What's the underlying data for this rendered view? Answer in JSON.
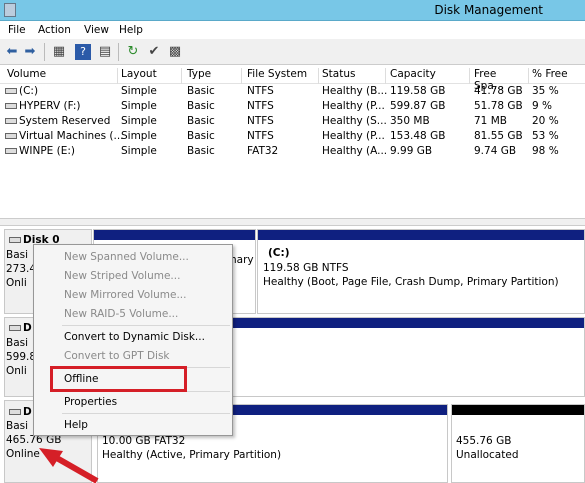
{
  "window": {
    "title": "Disk Management"
  },
  "menu": [
    "File",
    "Action",
    "View",
    "Help"
  ],
  "toolbar": [
    "back-icon",
    "forward-icon",
    "grid-icon",
    "help-icon",
    "console-icon",
    "refresh-icon",
    "properties-icon",
    "settings-icon"
  ],
  "columns": [
    "Volume",
    "Layout",
    "Type",
    "File System",
    "Status",
    "Capacity",
    "Free Spa...",
    "% Free"
  ],
  "volumes": [
    [
      "(C:)",
      "Simple",
      "Basic",
      "NTFS",
      "Healthy (B...",
      "119.58 GB",
      "41.78 GB",
      "35 %"
    ],
    [
      "HYPERV (F:)",
      "Simple",
      "Basic",
      "NTFS",
      "Healthy (P...",
      "599.87 GB",
      "51.78 GB",
      "9 %"
    ],
    [
      "System Reserved",
      "Simple",
      "Basic",
      "NTFS",
      "Healthy (S...",
      "350 MB",
      "71 MB",
      "20 %"
    ],
    [
      "Virtual Machines (...",
      "Simple",
      "Basic",
      "NTFS",
      "Healthy (P...",
      "153.48 GB",
      "81.55 GB",
      "53 %"
    ],
    [
      "WINPE (E:)",
      "Simple",
      "Basic",
      "FAT32",
      "Healthy (A...",
      "9.99 GB",
      "9.74 GB",
      "98 %"
    ]
  ],
  "disks": {
    "d0": {
      "name": "Disk 0",
      "type": "Basi",
      "size": "273.4",
      "status": "Onli",
      "p_frag": "nary",
      "c_name": "(C:)",
      "c_size": "119.58 GB NTFS",
      "c_status": "Healthy (Boot, Page File, Crash Dump, Primary Partition)"
    },
    "d1": {
      "name": "D",
      "type": "Basi",
      "size": "599.8",
      "status": "Onli"
    },
    "d2": {
      "name": "D",
      "type": "Basi",
      "size": "465.76 GB",
      "status": "Online",
      "p1_size": "10.00 GB FAT32",
      "p1_status": "Healthy (Active, Primary Partition)",
      "p2_size": "455.76 GB",
      "p2_status": "Unallocated"
    }
  },
  "context_menu": {
    "spanned": "New Spanned Volume...",
    "striped": "New Striped Volume...",
    "mirrored": "New Mirrored Volume...",
    "raid5": "New RAID-5 Volume...",
    "dynamic": "Convert to Dynamic Disk...",
    "gpt": "Convert to GPT Disk",
    "offline": "Offline",
    "properties": "Properties",
    "help": "Help"
  },
  "colors": {
    "titlebar": "#78c7e7",
    "partition_bar": "#0f2080",
    "unallocated": "#000000",
    "highlight": "#d51f27"
  }
}
